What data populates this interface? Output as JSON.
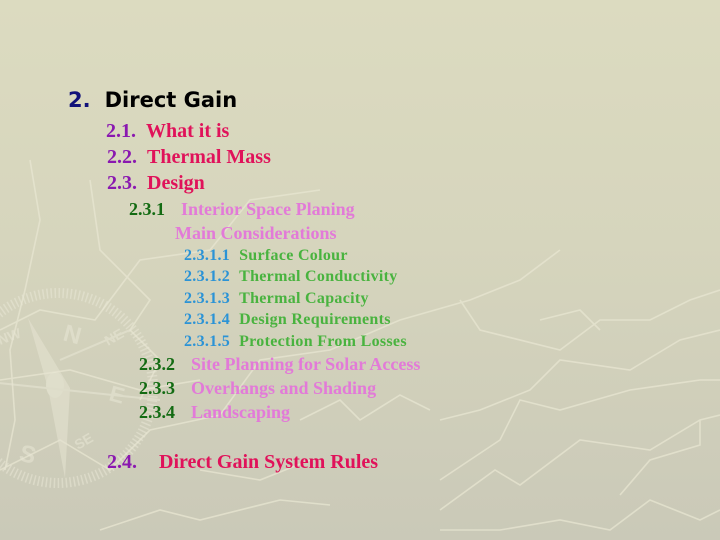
{
  "slide": {
    "heading": {
      "number": "2.",
      "label": "Direct Gain"
    },
    "sections": [
      {
        "number": "2.1.",
        "label": "What it is"
      },
      {
        "number": "2.2.",
        "label": "Thermal Mass"
      },
      {
        "number": "2.3.",
        "label": "Design"
      }
    ],
    "design_items": {
      "first": {
        "number": "2.3.1",
        "label": "Interior Space Planing",
        "sublabel": "Main Considerations"
      },
      "considerations": [
        {
          "number": "2.3.1.1",
          "label": "Surface Colour"
        },
        {
          "number": "2.3.1.2",
          "label": "Thermal Conductivity"
        },
        {
          "number": "2.3.1.3",
          "label": "Thermal Capacity"
        },
        {
          "number": "2.3.1.4",
          "label": "Design Requirements"
        },
        {
          "number": "2.3.1.5",
          "label": "Protection From Losses"
        }
      ],
      "rest": [
        {
          "number": "2.3.2",
          "label": "Site Planning for Solar Access"
        },
        {
          "number": "2.3.3",
          "label": "Overhangs and Shading"
        },
        {
          "number": "2.3.4",
          "label": "Landscaping"
        }
      ]
    },
    "last_section": {
      "number": "2.4.",
      "label": "Direct Gain System Rules"
    },
    "compass_letters": {
      "north": "N",
      "south": "S",
      "east": "E",
      "ne": "NE",
      "nw": "NW",
      "se": "SE"
    },
    "colors": {
      "background": "#d6d5bd",
      "heading_number": "#12127a",
      "heading_label": "#000000",
      "section_number": "#8a18b0",
      "section_label": "#e0125a",
      "subsection_number": "#136b13",
      "subsection_label": "#e27ad8",
      "item_number": "#2b93d6",
      "item_label": "#49b33f"
    }
  }
}
